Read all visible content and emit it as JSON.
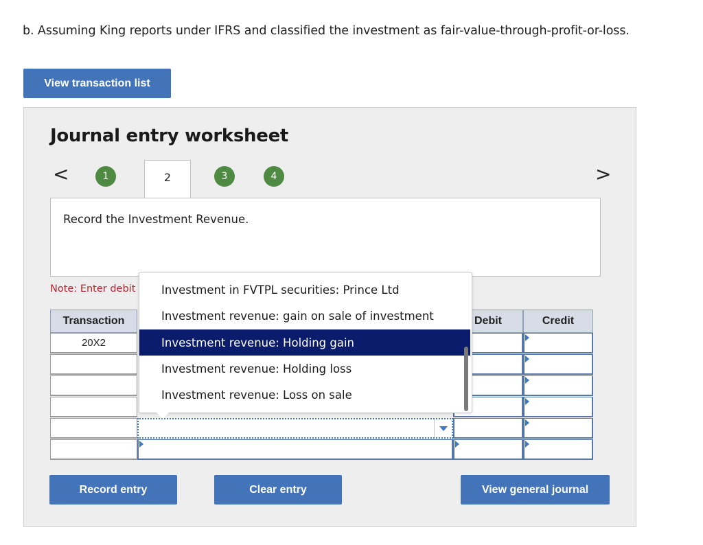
{
  "question": "b. Assuming King reports under IFRS and classified the investment as fair-value-through-profit-or-loss.",
  "buttons": {
    "view_transaction_list": "View transaction list",
    "record_entry": "Record entry",
    "clear_entry": "Clear entry",
    "view_general_journal": "View general journal"
  },
  "worksheet": {
    "title": "Journal entry worksheet",
    "prev_arrow": "<",
    "next_arrow": ">",
    "steps": [
      "1",
      "2",
      "3",
      "4"
    ],
    "active_step": "2",
    "instruction": "Record the Investment Revenue.",
    "note": "Note: Enter debit"
  },
  "table": {
    "headers": {
      "transaction": "Transaction",
      "debit": "Debit",
      "credit": "Credit"
    },
    "rows": [
      {
        "transaction": "20X2"
      },
      {
        "transaction": ""
      },
      {
        "transaction": ""
      },
      {
        "transaction": ""
      },
      {
        "transaction": ""
      },
      {
        "transaction": ""
      }
    ]
  },
  "dropdown": {
    "options": [
      "Investment in FVTPL securities: Prince Ltd",
      "Investment revenue: gain on sale of investment",
      "Investment revenue: Holding gain",
      "Investment revenue: Holding loss",
      "Investment revenue: Loss on sale"
    ],
    "highlighted": "Investment revenue: Holding gain"
  },
  "colors": {
    "button": "#4373b8",
    "step_circle": "#4e8a41",
    "note_text": "#b4232a",
    "highlight": "#0a1c6b",
    "grid_border": "#5877a9"
  },
  "icons": {
    "caret": "chevron-down-icon",
    "cell_marker": "triangle-right-icon"
  }
}
